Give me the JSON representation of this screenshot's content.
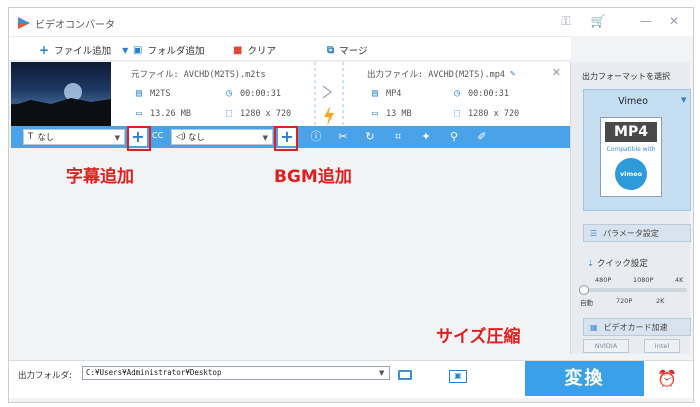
{
  "window": {
    "title": "ビデオコンバータ"
  },
  "toolbar": {
    "add_file": "ファイル追加",
    "add_folder": "フォルダ追加",
    "clear": "クリア",
    "merge": "マージ"
  },
  "item": {
    "source_label": "元ファイル: AVCHD(M2TS).m2ts",
    "source_format": "M2TS",
    "source_duration": "00:00:31",
    "source_size": "13.26 MB",
    "source_resolution": "1280 x 720",
    "output_label": "出力ファイル: AVCHD(M2TS).mp4",
    "output_format": "MP4",
    "output_duration": "00:00:31",
    "output_size": "13 MB",
    "output_resolution": "1280 x 720"
  },
  "editbar": {
    "subtitle_select": "なし",
    "audio_select": "なし",
    "cc_text": "CC"
  },
  "annotations": {
    "subtitle_add": "字幕追加",
    "bgm_add": "BGM追加",
    "size_compress": "サイズ圧縮"
  },
  "bottom": {
    "output_folder_label": "出力フォルダ:",
    "output_path": "C:¥Users¥Administrator¥Desktop",
    "convert_button": "変換"
  },
  "right_panel": {
    "title": "出力フォーマットを選択",
    "format_name": "Vimeo",
    "doc_format": "MP4",
    "doc_compat": "Compatible with",
    "doc_logo": "vimeo",
    "param_button": "パラメータ設定",
    "quick_label": "クイック設定",
    "slider_top": [
      "480P",
      "1080P",
      "4K"
    ],
    "slider_bottom": [
      "自動",
      "720P",
      "2K"
    ],
    "gpu_button": "ビデオカード加速",
    "chip_nvidia": "NVIDIA",
    "chip_intel": "Intel"
  },
  "colors": {
    "accent": "#3aa0ea",
    "annotation": "#e01f1f",
    "editbar": "#4aa3e8"
  }
}
